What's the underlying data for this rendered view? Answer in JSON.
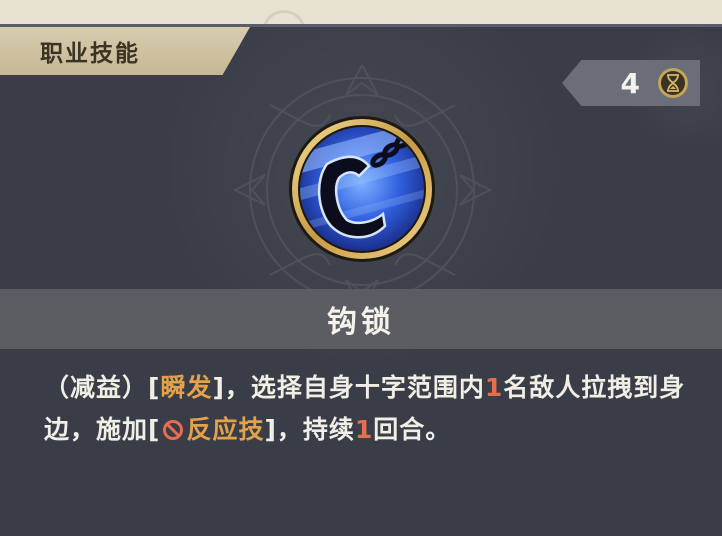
{
  "header": {
    "title": "职业技能"
  },
  "cooldown": {
    "value": "4",
    "icon": "hourglass-icon"
  },
  "skill": {
    "icon": "grappling-hook-icon",
    "name": "钩锁"
  },
  "description": {
    "prefix": "（减益）[",
    "tag_instant": "瞬发",
    "part1": "]，选择自身十字范围内",
    "count": "1",
    "part2": "名敌人拉拽到身边，施加[",
    "status_icon": "no-reaction-icon",
    "tag_reaction": "反应技",
    "part3": "]，持续",
    "duration": "1",
    "part4": "回合。"
  },
  "colors": {
    "card_bg": "#393d47",
    "tab_bg": "#d7ccb0",
    "highlight_gold": "#e3a24a",
    "highlight_red": "#e86d4f",
    "icon_blue": "#2f5bd8",
    "icon_gold_ring": "#d9b35a"
  }
}
